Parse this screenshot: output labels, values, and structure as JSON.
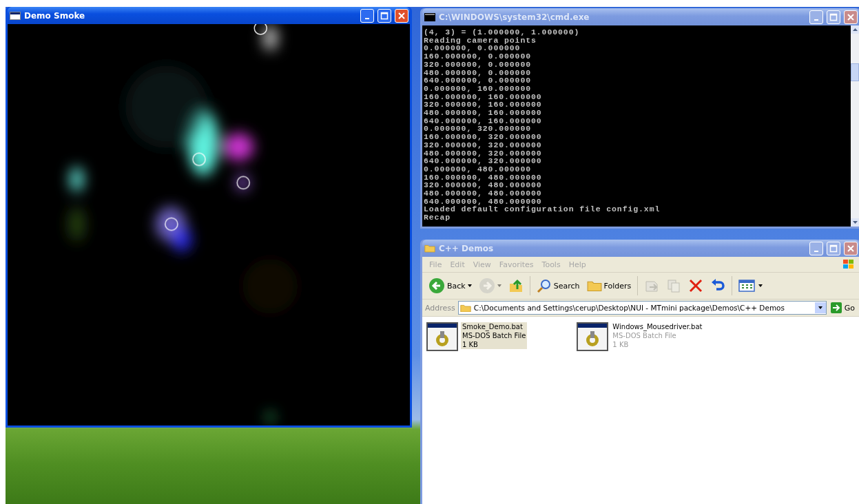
{
  "smoke_window": {
    "title": "Demo Smoke",
    "active": true
  },
  "console_window": {
    "title": "C:\\WINDOWS\\system32\\cmd.exe",
    "active": false,
    "lines": [
      "(4, 3) = (1.000000, 1.000000)",
      "Reading camera points",
      "0.000000, 0.000000",
      "160.000000, 0.000000",
      "320.000000, 0.000000",
      "480.000000, 0.000000",
      "640.000000, 0.000000",
      "0.000000, 160.000000",
      "160.000000, 160.000000",
      "320.000000, 160.000000",
      "480.000000, 160.000000",
      "640.000000, 160.000000",
      "0.000000, 320.000000",
      "160.000000, 320.000000",
      "320.000000, 320.000000",
      "480.000000, 320.000000",
      "640.000000, 320.000000",
      "0.000000, 480.000000",
      "160.000000, 480.000000",
      "320.000000, 480.000000",
      "480.000000, 480.000000",
      "640.000000, 480.000000",
      "Loaded default configuration file config.xml",
      "Recap"
    ]
  },
  "explorer_window": {
    "title": "C++ Demos",
    "active": false,
    "menu": [
      "File",
      "Edit",
      "View",
      "Favorites",
      "Tools",
      "Help"
    ],
    "toolbar": [
      {
        "kind": "back",
        "label": "Back",
        "disabled": false
      },
      {
        "kind": "forward",
        "disabled": true
      },
      {
        "kind": "up",
        "disabled": false
      },
      {
        "kind": "search",
        "label": "Search",
        "disabled": false
      },
      {
        "kind": "folders",
        "label": "Folders",
        "disabled": false
      },
      {
        "kind": "move",
        "disabled": true
      },
      {
        "kind": "copy",
        "disabled": true
      },
      {
        "kind": "delete",
        "disabled": false
      },
      {
        "kind": "undo",
        "disabled": false
      },
      {
        "kind": "views",
        "disabled": false
      }
    ],
    "address": {
      "label": "Address",
      "value": "C:\\Documents and Settings\\cerup\\Desktop\\NUI - MTmini package\\Demos\\C++ Demos",
      "go": "Go"
    },
    "files": [
      {
        "name": "Smoke_Demo.bat",
        "type": "MS-DOS Batch File",
        "size": "1 KB",
        "selected": true
      },
      {
        "name": "Windows_Mousedriver.bat",
        "type": "MS-DOS Batch File",
        "size": "1 KB",
        "selected": false
      }
    ]
  }
}
